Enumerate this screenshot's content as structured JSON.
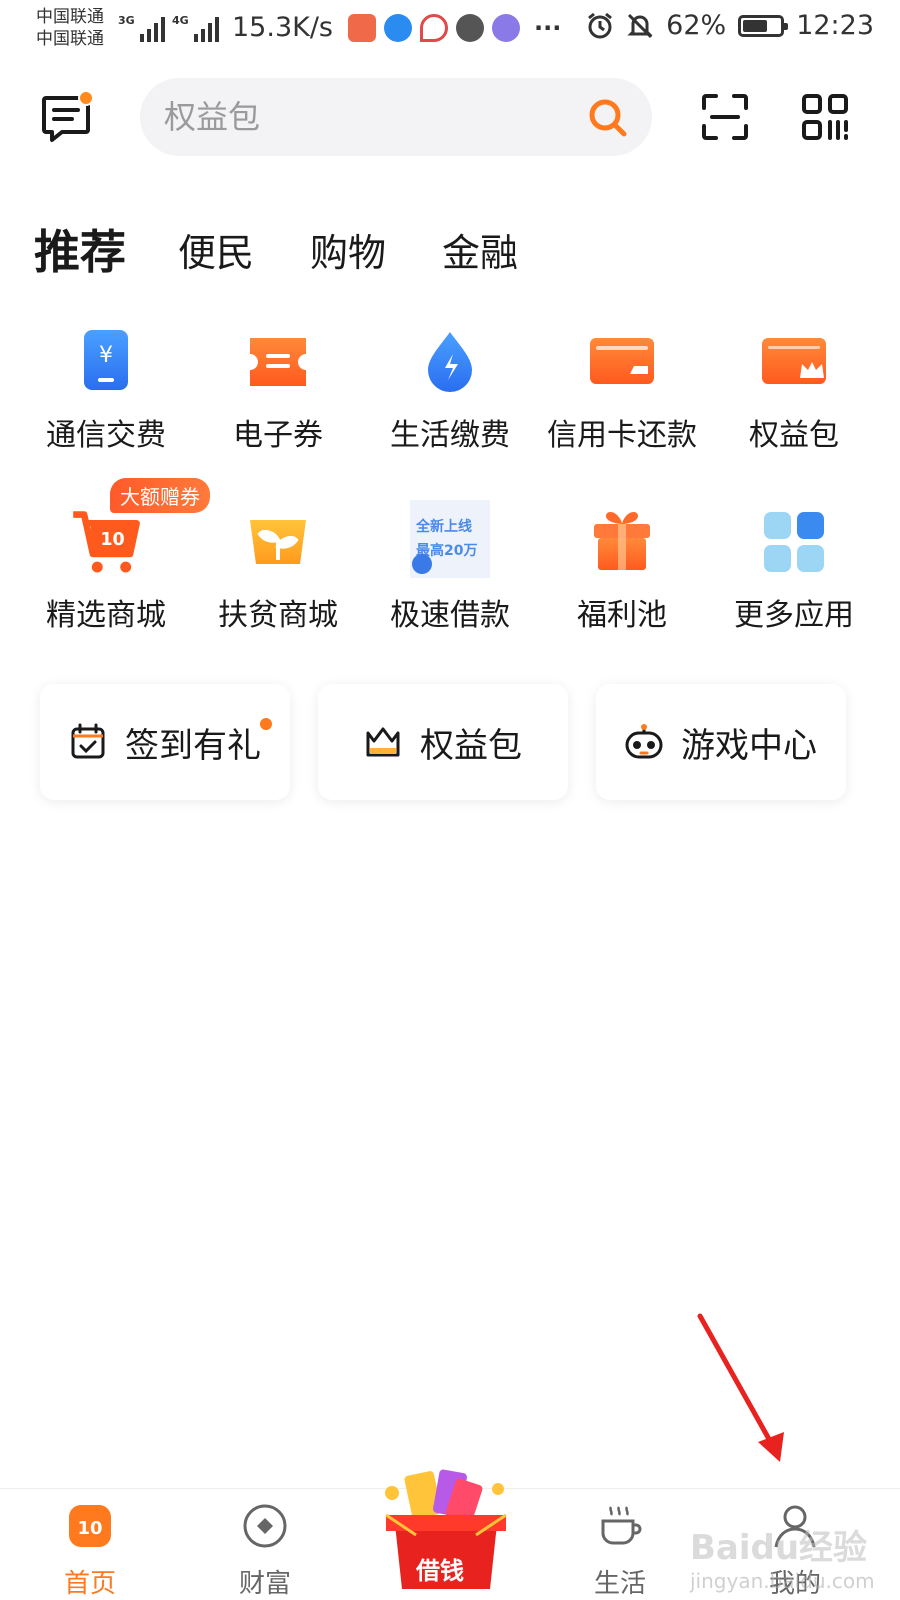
{
  "status_bar": {
    "carrier_1": "中国联通",
    "carrier_2": "中国联通",
    "signal_1_label": "3G",
    "signal_2_label": "4G",
    "net_speed": "15.3K/s",
    "more": "···",
    "battery": "62%",
    "battery_level": 0.62,
    "time": "12:23"
  },
  "top_bar": {
    "search_placeholder": "权益包",
    "message_icon": "message-icon",
    "search_icon": "search-icon",
    "scan_icon": "scan-icon",
    "qr_icon": "qrcode-icon"
  },
  "tabs": [
    {
      "label": "推荐",
      "active": true
    },
    {
      "label": "便民",
      "active": false
    },
    {
      "label": "购物",
      "active": false
    },
    {
      "label": "金融",
      "active": false
    }
  ],
  "grid": {
    "row1": [
      {
        "label": "通信交费",
        "icon": "phone-recharge-icon"
      },
      {
        "label": "电子券",
        "icon": "coupon-icon"
      },
      {
        "label": "生活缴费",
        "icon": "water-drop-icon"
      },
      {
        "label": "信用卡还款",
        "icon": "credit-card-icon"
      },
      {
        "label": "权益包",
        "icon": "crown-card-icon"
      }
    ],
    "row2": [
      {
        "label": "精选商城",
        "icon": "shopping-cart-icon",
        "badge": "大额赠券"
      },
      {
        "label": "扶贫商城",
        "icon": "sprout-icon"
      },
      {
        "label": "极速借款",
        "icon": "loan-promo-icon",
        "promo_line1": "全新上线",
        "promo_line2": "最高20万"
      },
      {
        "label": "福利池",
        "icon": "gift-icon"
      },
      {
        "label": "更多应用",
        "icon": "apps-grid-icon"
      }
    ]
  },
  "cards": [
    {
      "label": "签到有礼",
      "icon": "calendar-check-icon",
      "dot": true
    },
    {
      "label": "权益包",
      "icon": "crown-icon",
      "dot": false
    },
    {
      "label": "游戏中心",
      "icon": "game-controller-icon",
      "dot": false
    }
  ],
  "bottom_nav": [
    {
      "label": "首页",
      "icon": "home-icon",
      "active": true
    },
    {
      "label": "财富",
      "icon": "wealth-icon",
      "active": false
    },
    {
      "label": "借钱",
      "icon": "borrow-gift-icon",
      "active": false
    },
    {
      "label": "生活",
      "icon": "coffee-icon",
      "active": false
    },
    {
      "label": "我的",
      "icon": "profile-icon",
      "active": false
    }
  ],
  "colors": {
    "accent": "#ff7a1e",
    "search_bg": "#f3f3f5",
    "annotation_arrow": "#e8231f"
  },
  "watermark": {
    "brand": "Baidu经验",
    "url": "jingyan.baidu.com"
  }
}
